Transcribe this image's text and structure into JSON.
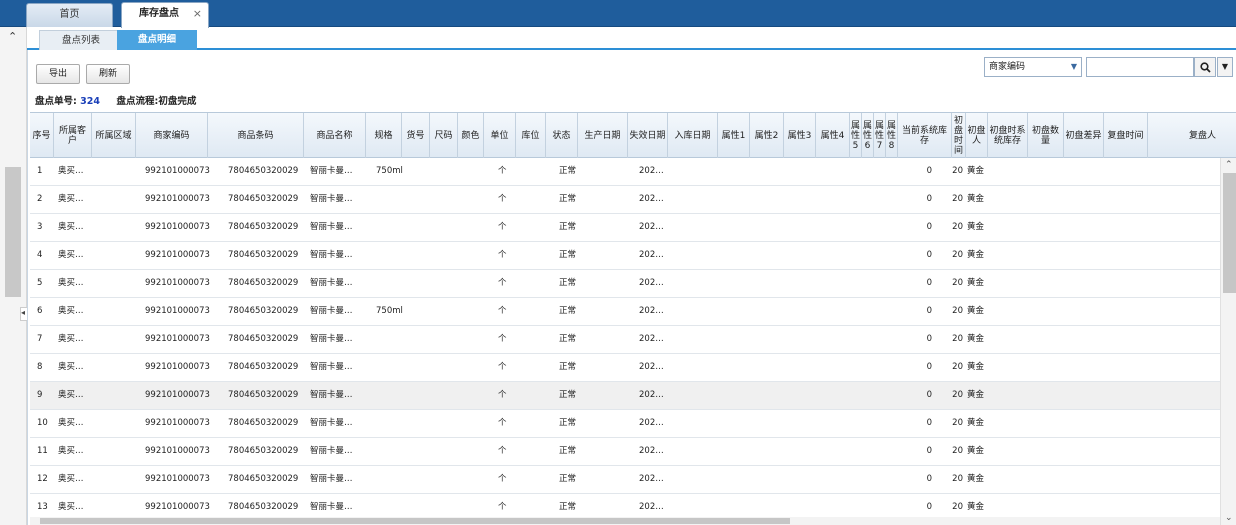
{
  "top_tabs": {
    "home": "首页",
    "inventory": "库存盘点",
    "close": "×"
  },
  "sub_tabs": {
    "list": "盘点列表",
    "detail": "盘点明细"
  },
  "toolbar": {
    "export": "导出",
    "refresh": "刷新",
    "search_field": "商家编码",
    "search_icon": "search-icon",
    "dropdown_icon": "▼"
  },
  "info": {
    "order_label": "盘点单号:",
    "order_no": "324",
    "flow_label": "盘点流程:初盘完成"
  },
  "columns": [
    "序号",
    "所属客户",
    "所属区域",
    "商家编码",
    "商品条码",
    "商品名称",
    "规格",
    "货号",
    "尺码",
    "颜色",
    "单位",
    "库位",
    "状态",
    "生产日期",
    "失效日期",
    "入库日期",
    "属性1",
    "属性2",
    "属性3",
    "属性4",
    "属性5",
    "属性6",
    "属性7",
    "属性8",
    "当前系统库存",
    "初盘时间",
    "初盘人",
    "初盘时系统库存",
    "初盘数量",
    "初盘差异",
    "复盘时间",
    "复盘人"
  ],
  "rows": [
    {
      "no": "1",
      "customer": "奥买…",
      "code": "992101000073",
      "barcode": "7804650320029",
      "name": "智丽卡曼…",
      "spec": "750ml",
      "unit": "个",
      "status": "正常",
      "expiry": "202…",
      "stock": "0",
      "qty": "20",
      "person": "黄金"
    },
    {
      "no": "2",
      "customer": "奥买…",
      "code": "992101000073",
      "barcode": "7804650320029",
      "name": "智丽卡曼…",
      "spec": "",
      "unit": "个",
      "status": "正常",
      "expiry": "202…",
      "stock": "0",
      "qty": "20",
      "person": "黄金"
    },
    {
      "no": "3",
      "customer": "奥买…",
      "code": "992101000073",
      "barcode": "7804650320029",
      "name": "智丽卡曼…",
      "spec": "",
      "unit": "个",
      "status": "正常",
      "expiry": "202…",
      "stock": "0",
      "qty": "20",
      "person": "黄金"
    },
    {
      "no": "4",
      "customer": "奥买…",
      "code": "992101000073",
      "barcode": "7804650320029",
      "name": "智丽卡曼…",
      "spec": "",
      "unit": "个",
      "status": "正常",
      "expiry": "202…",
      "stock": "0",
      "qty": "20",
      "person": "黄金"
    },
    {
      "no": "5",
      "customer": "奥买…",
      "code": "992101000073",
      "barcode": "7804650320029",
      "name": "智丽卡曼…",
      "spec": "",
      "unit": "个",
      "status": "正常",
      "expiry": "202…",
      "stock": "0",
      "qty": "20",
      "person": "黄金"
    },
    {
      "no": "6",
      "customer": "奥买…",
      "code": "992101000073",
      "barcode": "7804650320029",
      "name": "智丽卡曼…",
      "spec": "750ml",
      "unit": "个",
      "status": "正常",
      "expiry": "202…",
      "stock": "0",
      "qty": "20",
      "person": "黄金"
    },
    {
      "no": "7",
      "customer": "奥买…",
      "code": "992101000073",
      "barcode": "7804650320029",
      "name": "智丽卡曼…",
      "spec": "",
      "unit": "个",
      "status": "正常",
      "expiry": "202…",
      "stock": "0",
      "qty": "20",
      "person": "黄金"
    },
    {
      "no": "8",
      "customer": "奥买…",
      "code": "992101000073",
      "barcode": "7804650320029",
      "name": "智丽卡曼…",
      "spec": "",
      "unit": "个",
      "status": "正常",
      "expiry": "202…",
      "stock": "0",
      "qty": "20",
      "person": "黄金"
    },
    {
      "no": "9",
      "customer": "奥买…",
      "code": "992101000073",
      "barcode": "7804650320029",
      "name": "智丽卡曼…",
      "spec": "",
      "unit": "个",
      "status": "正常",
      "expiry": "202…",
      "stock": "0",
      "qty": "20",
      "person": "黄金"
    },
    {
      "no": "10",
      "customer": "奥买…",
      "code": "992101000073",
      "barcode": "7804650320029",
      "name": "智丽卡曼…",
      "spec": "",
      "unit": "个",
      "status": "正常",
      "expiry": "202…",
      "stock": "0",
      "qty": "20",
      "person": "黄金"
    },
    {
      "no": "11",
      "customer": "奥买…",
      "code": "992101000073",
      "barcode": "7804650320029",
      "name": "智丽卡曼…",
      "spec": "",
      "unit": "个",
      "status": "正常",
      "expiry": "202…",
      "stock": "0",
      "qty": "20",
      "person": "黄金"
    },
    {
      "no": "12",
      "customer": "奥买…",
      "code": "992101000073",
      "barcode": "7804650320029",
      "name": "智丽卡曼…",
      "spec": "",
      "unit": "个",
      "status": "正常",
      "expiry": "202…",
      "stock": "0",
      "qty": "20",
      "person": "黄金"
    },
    {
      "no": "13",
      "customer": "奥买…",
      "code": "992101000073",
      "barcode": "7804650320029",
      "name": "智丽卡曼…",
      "spec": "",
      "unit": "个",
      "status": "正常",
      "expiry": "202…",
      "stock": "0",
      "qty": "20",
      "person": "黄金"
    }
  ]
}
